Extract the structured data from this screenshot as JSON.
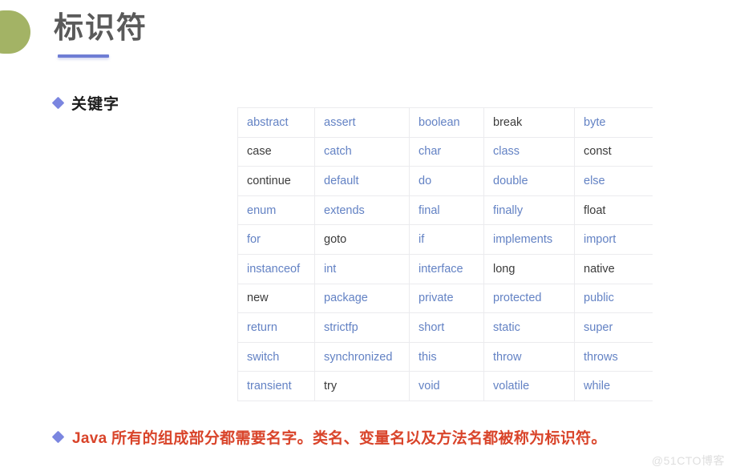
{
  "slide": {
    "title": "标识符",
    "accent_green": "#a3b365",
    "accent_blue": "#6f7dd4",
    "title_color": "#5a5a5a"
  },
  "subheading": {
    "bullet_icon": "diamond-bullet-icon",
    "label": "关键字"
  },
  "keyword_table": {
    "columns": 5,
    "rows": 10,
    "link_color": "#6382c4",
    "plain_color": "#3b3b3b",
    "grid_color": "#ebebee",
    "cells": [
      [
        {
          "text": "abstract",
          "style": "link"
        },
        {
          "text": "assert",
          "style": "link"
        },
        {
          "text": "boolean",
          "style": "link"
        },
        {
          "text": "break",
          "style": "plain"
        },
        {
          "text": "byte",
          "style": "link"
        }
      ],
      [
        {
          "text": "case",
          "style": "plain"
        },
        {
          "text": "catch",
          "style": "link"
        },
        {
          "text": "char",
          "style": "link"
        },
        {
          "text": "class",
          "style": "link"
        },
        {
          "text": "const",
          "style": "plain"
        }
      ],
      [
        {
          "text": "continue",
          "style": "plain"
        },
        {
          "text": "default",
          "style": "link"
        },
        {
          "text": "do",
          "style": "link"
        },
        {
          "text": "double",
          "style": "link"
        },
        {
          "text": "else",
          "style": "link"
        }
      ],
      [
        {
          "text": "enum",
          "style": "link"
        },
        {
          "text": "extends",
          "style": "link"
        },
        {
          "text": "final",
          "style": "link"
        },
        {
          "text": "finally",
          "style": "link"
        },
        {
          "text": "float",
          "style": "plain"
        }
      ],
      [
        {
          "text": "for",
          "style": "link"
        },
        {
          "text": "goto",
          "style": "plain"
        },
        {
          "text": "if",
          "style": "link"
        },
        {
          "text": "implements",
          "style": "link"
        },
        {
          "text": "import",
          "style": "link"
        }
      ],
      [
        {
          "text": "instanceof",
          "style": "link"
        },
        {
          "text": "int",
          "style": "link"
        },
        {
          "text": "interface",
          "style": "link"
        },
        {
          "text": "long",
          "style": "plain"
        },
        {
          "text": "native",
          "style": "plain"
        }
      ],
      [
        {
          "text": "new",
          "style": "plain"
        },
        {
          "text": "package",
          "style": "link"
        },
        {
          "text": "private",
          "style": "link"
        },
        {
          "text": "protected",
          "style": "link"
        },
        {
          "text": "public",
          "style": "link"
        }
      ],
      [
        {
          "text": "return",
          "style": "link"
        },
        {
          "text": "strictfp",
          "style": "link"
        },
        {
          "text": "short",
          "style": "link"
        },
        {
          "text": "static",
          "style": "link"
        },
        {
          "text": "super",
          "style": "link"
        }
      ],
      [
        {
          "text": "switch",
          "style": "link"
        },
        {
          "text": "synchronized",
          "style": "link"
        },
        {
          "text": "this",
          "style": "link"
        },
        {
          "text": "throw",
          "style": "link"
        },
        {
          "text": "throws",
          "style": "link"
        }
      ],
      [
        {
          "text": "transient",
          "style": "link"
        },
        {
          "text": "try",
          "style": "plain"
        },
        {
          "text": "void",
          "style": "link"
        },
        {
          "text": "volatile",
          "style": "link"
        },
        {
          "text": "while",
          "style": "link"
        }
      ]
    ]
  },
  "footer": {
    "bullet_icon": "diamond-bullet-icon",
    "text": "Java 所有的组成部分都需要名字。类名、变量名以及方法名都被称为标识符。",
    "color": "#d9442a"
  },
  "watermark": {
    "text": "@51CTO博客"
  }
}
